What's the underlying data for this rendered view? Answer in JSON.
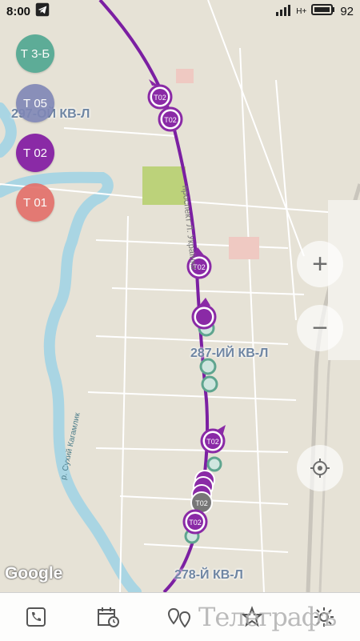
{
  "status": {
    "time": "8:00",
    "battery": "92",
    "network": "H+"
  },
  "routes": [
    {
      "label": "Т 3-Б",
      "color": "#4fa791"
    },
    {
      "label": "Т 05",
      "color": "#7f87b6"
    },
    {
      "label": "Т 02",
      "color": "#8a2aa6"
    },
    {
      "label": "Т 01",
      "color": "#e36e69"
    }
  ],
  "map": {
    "labels": {
      "district_top": "297-ОЙ КВ-Л",
      "district_mid": "287-ИЙ КВ-Л",
      "district_bottom": "278-Й КВ-Л",
      "street": "проспект Л. Українки",
      "river": "р. Сухий Кагамлик"
    },
    "marker_label": "Т02",
    "route_color": "#7b1fa2",
    "provider": "Google"
  },
  "controls": {
    "zoom_in": "+",
    "zoom_out": "−",
    "locate": "locate"
  },
  "bottom_nav": {
    "watermark": "Телеграфъ"
  }
}
